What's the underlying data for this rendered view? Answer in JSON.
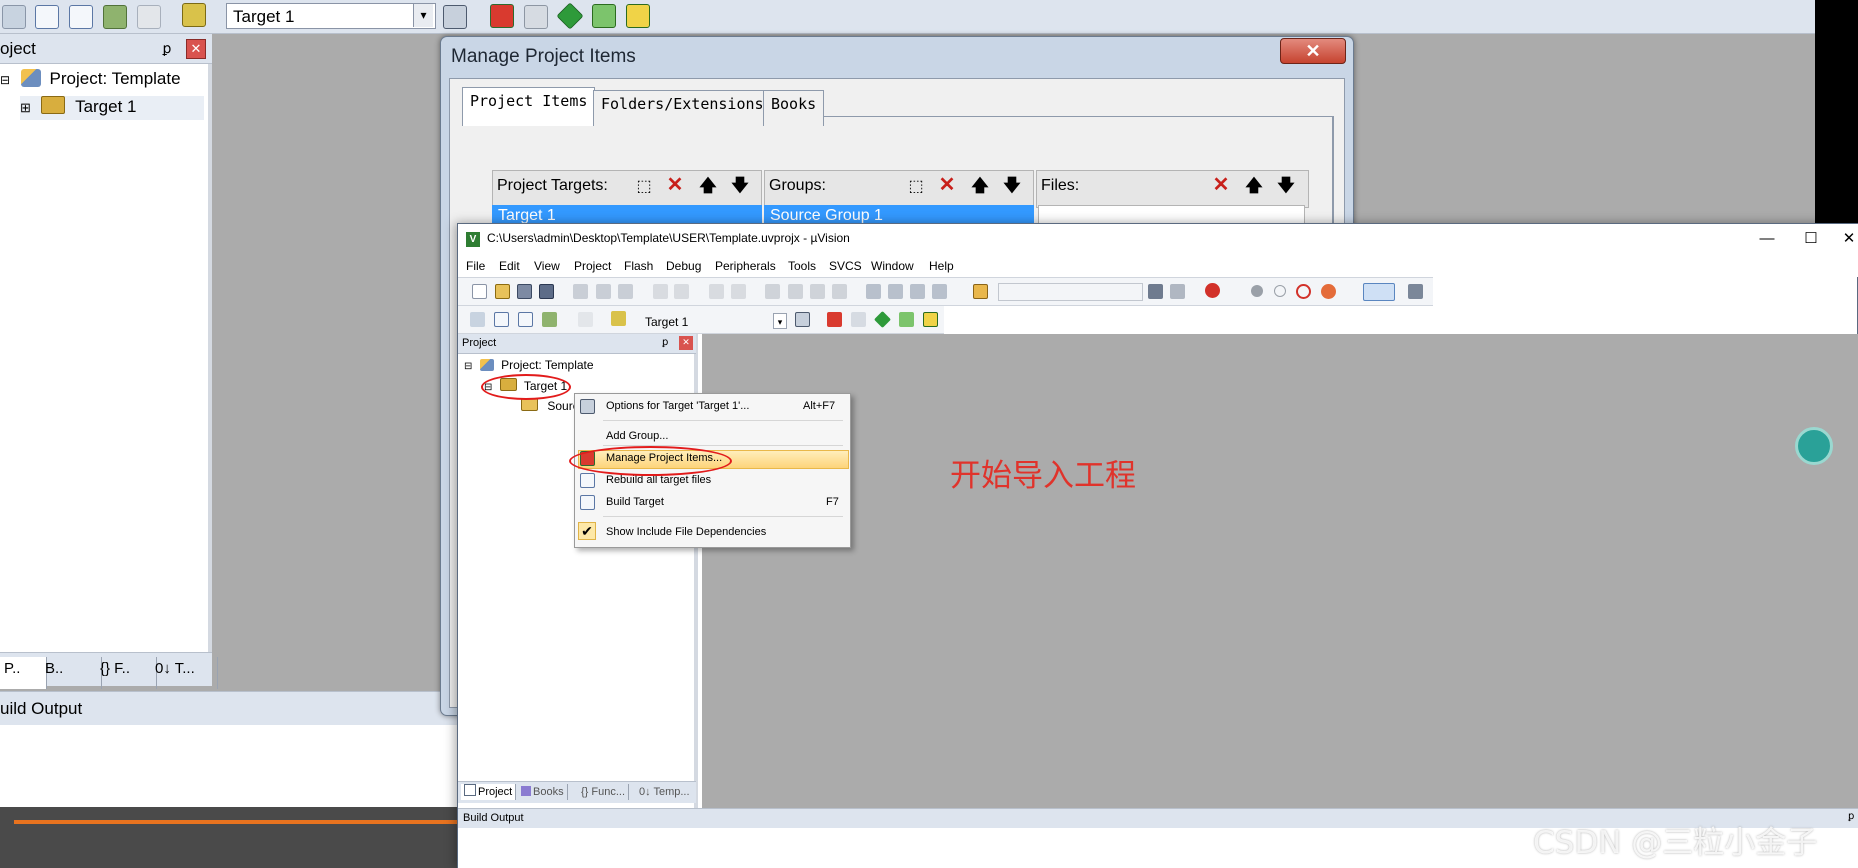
{
  "bg_window": {
    "target_select": "Target 1",
    "target_arrow": "▾",
    "panel_title": "oject",
    "pin_glyph": "ꝑ",
    "close_glyph": "✕",
    "tree": [
      {
        "label": "Project: Template",
        "expand": "⊟"
      },
      {
        "label": "Target 1",
        "expand": "⊞"
      }
    ],
    "bottom_tabs": [
      "P..",
      "B..",
      "{} F..",
      "0↓ T..."
    ],
    "build_output": "uild Output"
  },
  "dialog": {
    "title": "Manage Project Items",
    "close_glyph": "✕",
    "tabs": [
      "Project Items",
      "Folders/Extensions",
      "Books"
    ],
    "lists": {
      "targets": {
        "header": "Project Targets:",
        "selected": "Target 1"
      },
      "groups": {
        "header": "Groups:",
        "selected": "Source Group 1"
      },
      "files": {
        "header": "Files:"
      }
    },
    "button_glyphs": {
      "new": "⬚",
      "delete": "✕",
      "up": "🡅",
      "down": "🡇"
    }
  },
  "main_window": {
    "title": "C:\\Users\\admin\\Desktop\\Template\\USER\\Template.uvprojx - µVision",
    "app_icon": "V",
    "win_buttons": [
      "—",
      "☐",
      "✕"
    ],
    "menu": [
      "File",
      "Edit",
      "View",
      "Project",
      "Flash",
      "Debug",
      "Peripherals",
      "Tools",
      "SVCS",
      "Window",
      "Help"
    ],
    "target_select": "Target 1",
    "target_arrow": "▾",
    "panel_title": "Project",
    "pin_glyph": "ꝑ",
    "close_glyph": "✕",
    "tree": [
      {
        "label": "Project: Template",
        "expand": "⊟"
      },
      {
        "label": "Target 1",
        "expand": "⊟"
      },
      {
        "label": "Sourc",
        "expand": ""
      }
    ],
    "bottom_tabs": [
      "Project",
      "Books",
      "{} Func...",
      "0↓ Temp..."
    ],
    "build_output": "Build Output",
    "build_pin": "ꝑ"
  },
  "context_menu": {
    "items": [
      {
        "label": "Options for Target 'Target 1'...",
        "shortcut": "Alt+F7"
      },
      {
        "label": "Add Group...",
        "shortcut": ""
      },
      {
        "label": "Manage Project Items...",
        "shortcut": ""
      },
      {
        "label": "Rebuild all target files",
        "shortcut": ""
      },
      {
        "label": "Build Target",
        "shortcut": "F7"
      },
      {
        "label": "Show Include File Dependencies",
        "shortcut": ""
      }
    ],
    "check_glyph": "✔"
  },
  "annotation": "开始导入工程",
  "watermark": "CSDN @三粒小金子",
  "colors": {
    "selection_blue": "#3399ff",
    "menu_highlight": "#fdd47a",
    "annotation_red": "#e21b1b",
    "workspace_gray": "#ababab"
  }
}
